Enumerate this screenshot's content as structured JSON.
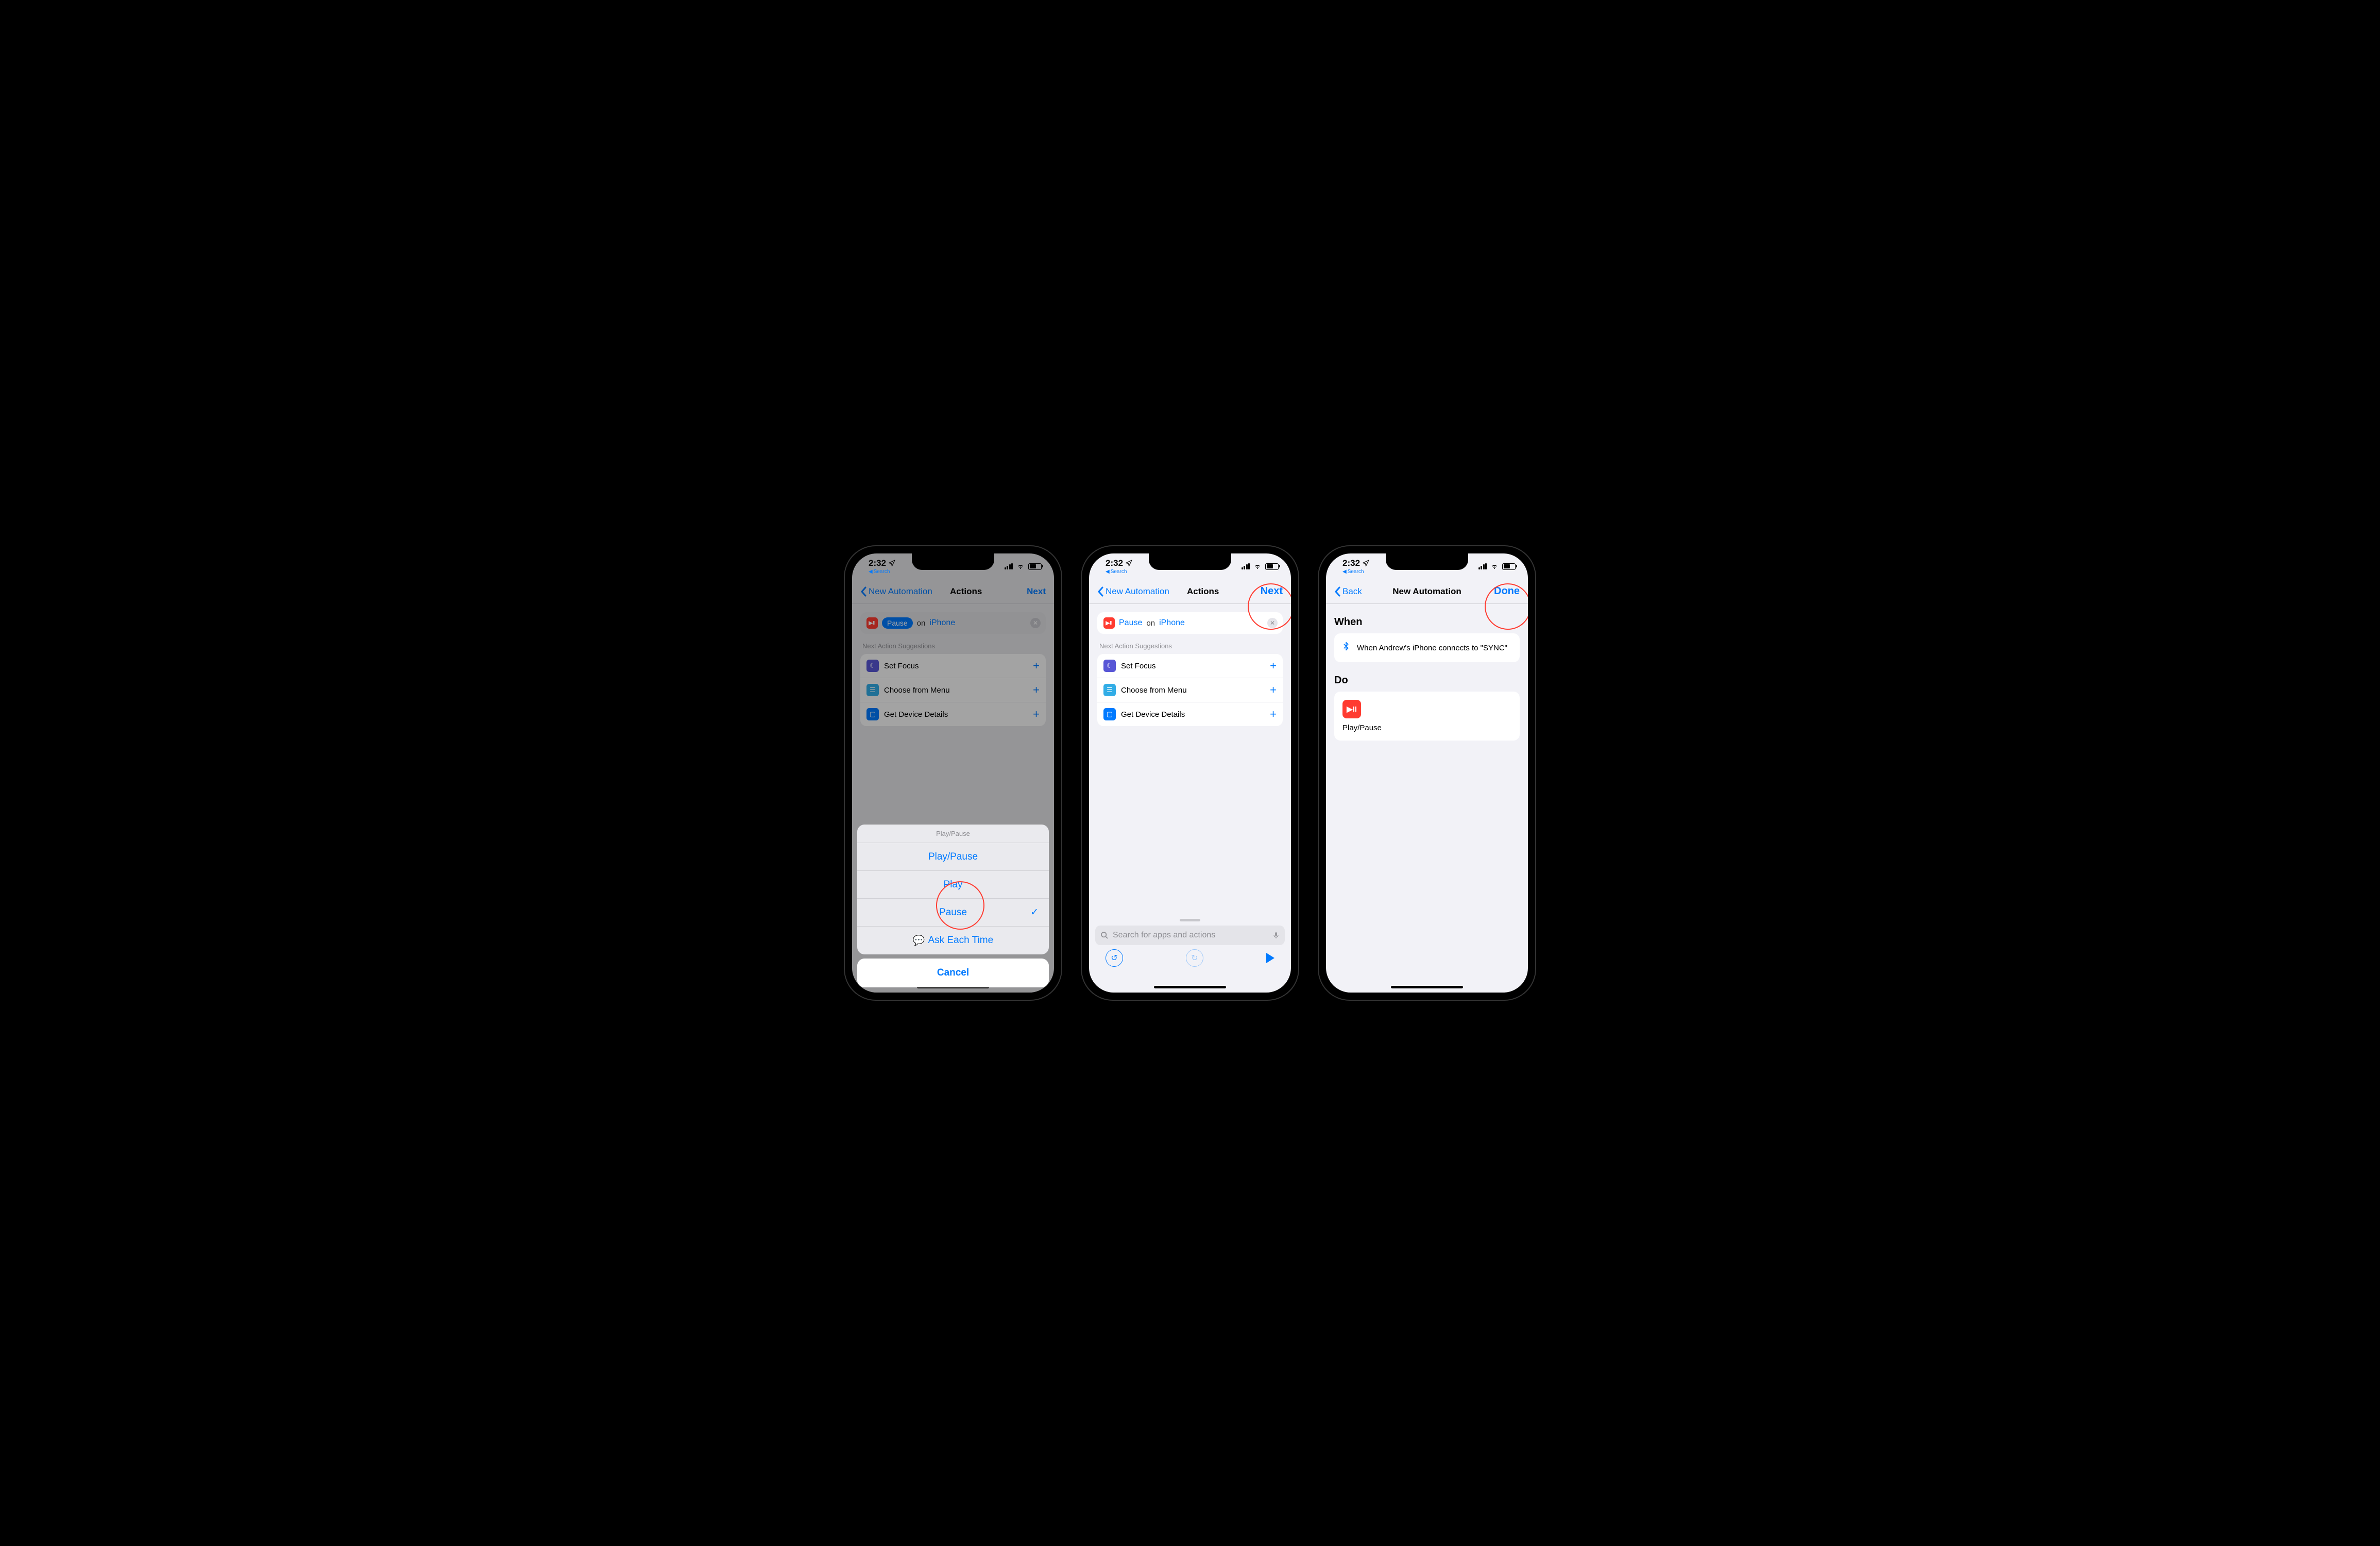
{
  "status": {
    "time": "2:32",
    "breadcrumb": "Search"
  },
  "nav": {
    "back1": "New Automation",
    "title_actions": "Actions",
    "next": "Next",
    "back3": "Back",
    "title_newauto": "New Automation",
    "done": "Done"
  },
  "action_row": {
    "pill_icon": "▶II",
    "pause": "Pause",
    "on": "on",
    "device": "iPhone"
  },
  "suggest": {
    "label": "Next Action Suggestions",
    "items": [
      {
        "label": "Set Focus",
        "icon": "moon"
      },
      {
        "label": "Choose from Menu",
        "icon": "menu"
      },
      {
        "label": "Get Device Details",
        "icon": "device"
      }
    ]
  },
  "sheet": {
    "header": "Play/Pause",
    "options": [
      "Play/Pause",
      "Play",
      "Pause"
    ],
    "ask": "Ask Each Time",
    "cancel": "Cancel",
    "selected_index": 2
  },
  "search": {
    "placeholder": "Search for apps and actions"
  },
  "screen3": {
    "when_label": "When",
    "when_text": "When Andrew's iPhone connects to \"SYNC\"",
    "do_label": "Do",
    "do_text": "Play/Pause"
  }
}
